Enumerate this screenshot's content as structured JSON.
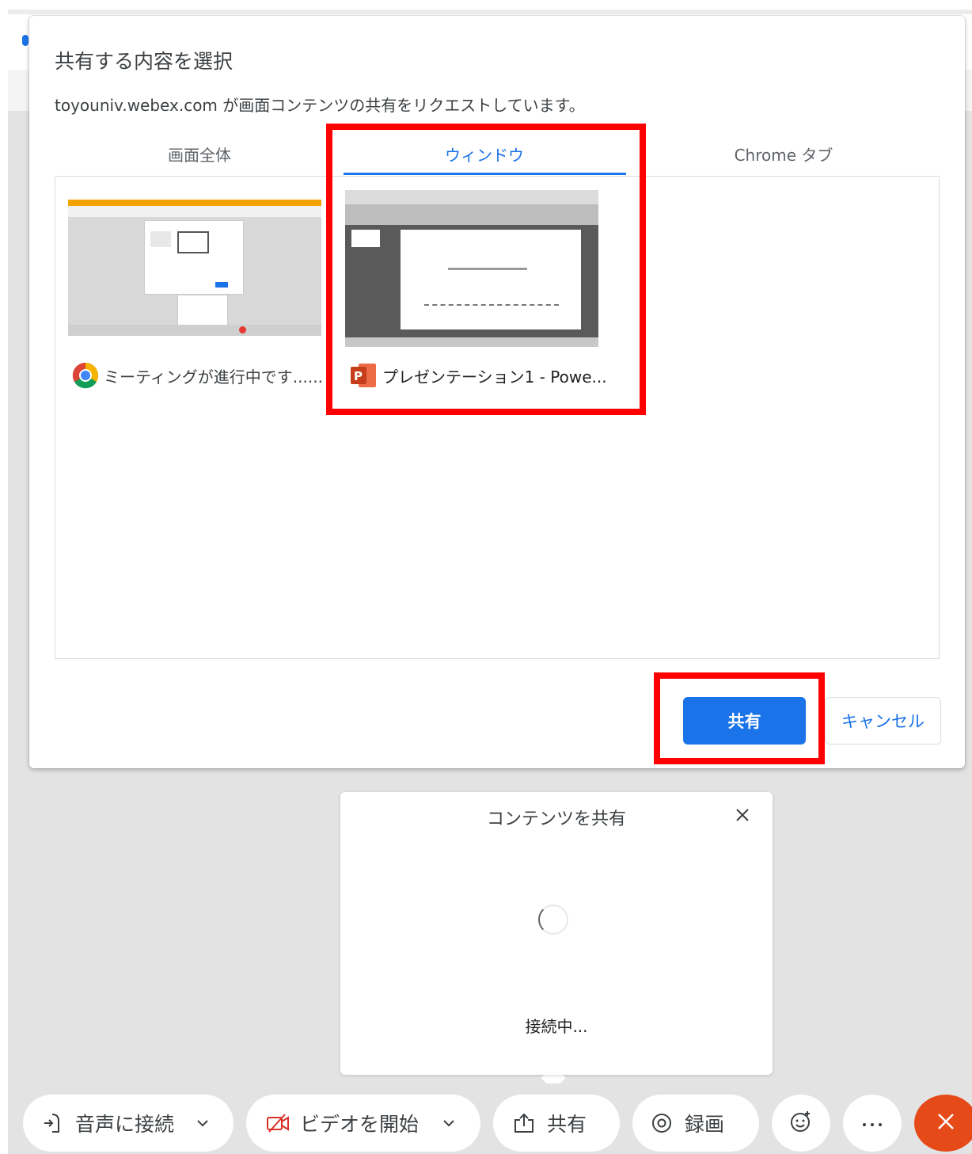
{
  "dialog": {
    "title": "共有する内容を選択",
    "subtitle": "toyouniv.webex.com が画面コンテンツの共有をリクエストしています。",
    "tabs": [
      {
        "label": "画面全体",
        "active": false
      },
      {
        "label": "ウィンドウ",
        "active": true
      },
      {
        "label": "Chrome タブ",
        "active": false
      }
    ],
    "items": [
      {
        "label": "ミーティングが進行中です......",
        "icon": "chrome-icon",
        "selected": false
      },
      {
        "label": "プレゼンテーション1 - Powe...",
        "icon": "powerpoint-icon",
        "selected": true
      }
    ],
    "share_label": "共有",
    "cancel_label": "キャンセル"
  },
  "popover": {
    "title": "コンテンツを共有",
    "status": "接続中..."
  },
  "toolbar": {
    "audio_label": "音声に接続",
    "video_label": "ビデオを開始",
    "share_label": "共有",
    "record_label": "録画"
  },
  "colors": {
    "accent": "#1a73e8",
    "highlight": "#ff0000",
    "leave": "#e64a19",
    "video_off": "#d93025"
  }
}
